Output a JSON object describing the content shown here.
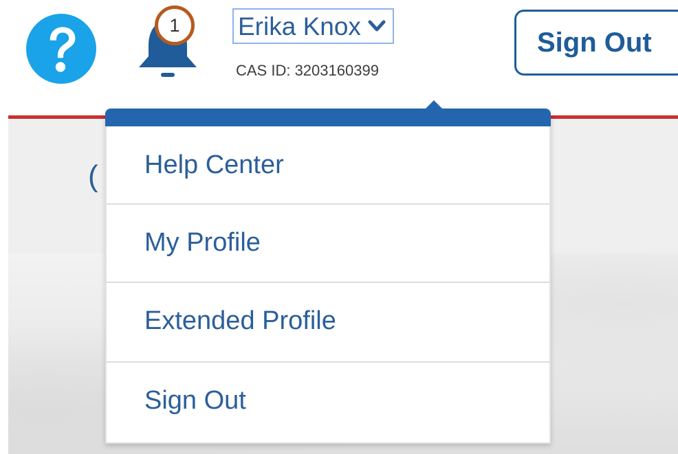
{
  "header": {
    "help_icon": "help-circle-icon",
    "bell_icon": "bell-icon",
    "notification_count": "1",
    "user_name": "Erika Knox",
    "chevron_icon": "chevron-down-icon",
    "cas_id": "CAS ID: 3203160399",
    "sign_out_label": "Sign Out"
  },
  "background": {
    "partial_text": "("
  },
  "user_menu": {
    "items": [
      {
        "label": "Help Center"
      },
      {
        "label": "My Profile"
      },
      {
        "label": "Extended Profile"
      },
      {
        "label": "Sign Out"
      }
    ]
  },
  "colors": {
    "brand_blue": "#2366ad",
    "text_blue": "#2b5e9a",
    "help_icon_blue": "#1aa3e8",
    "bell_blue": "#1f5c99",
    "badge_ring": "#b75a1e",
    "rule_red": "#c9302c"
  }
}
